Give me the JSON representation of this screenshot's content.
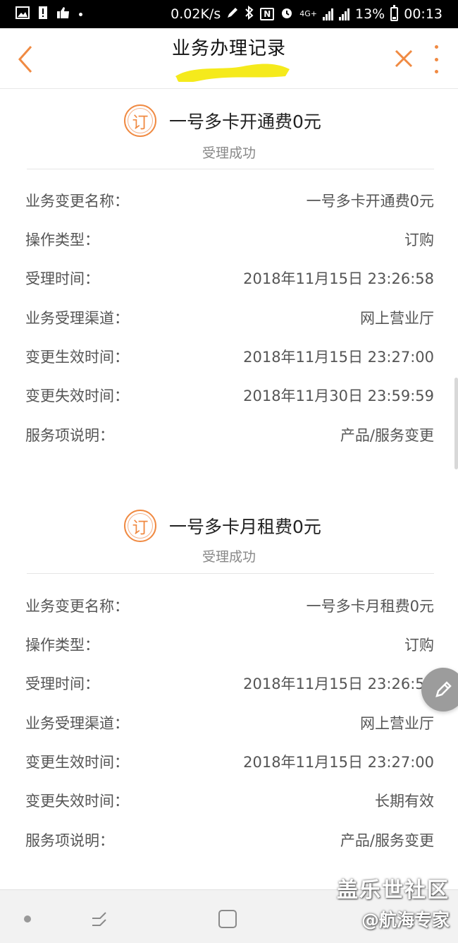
{
  "status_bar": {
    "net_speed": "0.02K/s",
    "net_type": "4G+",
    "battery": "13%",
    "time": "00:13"
  },
  "header": {
    "title": "业务办理记录"
  },
  "records": [
    {
      "badge": "订",
      "title": "一号多卡开通费0元",
      "status": "受理成功",
      "rows": [
        {
          "label": "业务变更名称：",
          "value": "一号多卡开通费0元"
        },
        {
          "label": "操作类型：",
          "value": "订购"
        },
        {
          "label": "受理时间：",
          "value": "2018年11月15日 23:26:58"
        },
        {
          "label": "业务受理渠道：",
          "value": "网上营业厅"
        },
        {
          "label": "变更生效时间：",
          "value": "2018年11月15日 23:27:00"
        },
        {
          "label": "变更失效时间：",
          "value": "2018年11月30日 23:59:59"
        },
        {
          "label": "服务项说明：",
          "value": "产品/服务变更"
        }
      ]
    },
    {
      "badge": "订",
      "title": "一号多卡月租费0元",
      "status": "受理成功",
      "rows": [
        {
          "label": "业务变更名称：",
          "value": "一号多卡月租费0元"
        },
        {
          "label": "操作类型：",
          "value": "订购"
        },
        {
          "label": "受理时间：",
          "value": "2018年11月15日 23:26:58"
        },
        {
          "label": "业务受理渠道：",
          "value": "网上营业厅"
        },
        {
          "label": "变更生效时间：",
          "value": "2018年11月15日 23:27:00"
        },
        {
          "label": "变更失效时间：",
          "value": "长期有效"
        },
        {
          "label": "服务项说明：",
          "value": "产品/服务变更"
        }
      ]
    }
  ],
  "watermark": {
    "line1": "盖乐世社区",
    "line2": "@航海专家"
  },
  "colors": {
    "accent": "#f08a42",
    "status_bar": "#000000",
    "redaction": "#f5ea1c"
  },
  "icons": [
    "image-icon",
    "alert-icon",
    "thumbs-up-icon",
    "pen-icon",
    "bluetooth-icon",
    "nfc-icon",
    "alarm-icon",
    "signal-icon",
    "battery-icon",
    "back-icon",
    "close-icon",
    "more-icon",
    "edit-icon"
  ]
}
